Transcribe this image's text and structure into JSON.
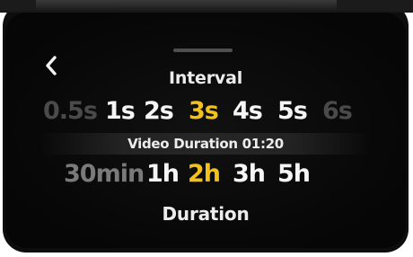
{
  "screen": {
    "interval": {
      "title": "Interval",
      "options": [
        "0.5s",
        "1s",
        "2s",
        "3s",
        "4s",
        "5s",
        "6s"
      ],
      "selected": "3s"
    },
    "video_duration": {
      "text": "Video Duration 01:20"
    },
    "duration": {
      "title": "Duration",
      "options": [
        "30min",
        "1h",
        "2h",
        "3h",
        "5h"
      ],
      "selected": "2h"
    },
    "icons": {
      "back": "chevron-left-icon",
      "handle": "drag-handle"
    },
    "colors": {
      "accent": "#f3c21a",
      "text": "#f5f5f5",
      "background": "#0a0a0a"
    }
  }
}
